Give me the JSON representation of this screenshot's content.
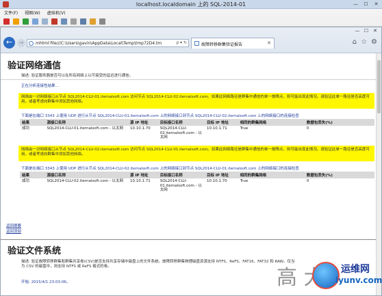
{
  "window": {
    "title": "localhost.localdomain 上的 SQL-2014-01"
  },
  "menu": [
    "文件(F)",
    "视图(W)",
    "虚拟机(V)"
  ],
  "toolbar_icons": [
    "stop-icon",
    "pause-icon",
    "play-icon",
    "snapshot-icon",
    "revert-icon",
    "power-icon",
    "reset-icon",
    "send-keys-icon",
    "usb-icon",
    "network-icon",
    "settings-icon"
  ],
  "browser": {
    "address": "mhtml:file///C:\\Users\\gavin\\AppData\\Local\\Temp\\tmp72D4.tm",
    "address_controls": "ρ ▾ ↻",
    "tab_label": "故障转移群集验证报告"
  },
  "section1": {
    "title": "验证网络通信",
    "description": "描述: 验证服务器是否可以在所有网络上以可接受的延迟进行通信。",
    "status_link": "正在分析连接性结果...",
    "warning1": "网络由一对网络接口从节点 SQL2014-CLU-01.iternalsoft.com 访问节点 SQL2014-CLU-02.iternalsoft.com。如果此网络路径是群集中通信的单一故障点，则可能出现此情况。请验证此单一路径是否高度可用，或者考虑向群集中添加其他网络。",
    "udp1": "下面是在端口 3343 上使用 UDP 进行从节点 SQL2014-CLU-01.iternalsoft.com 上的网络接口到节点 SQL2014-CLU-02.iternalsoft.com 上的网络接口的连接检查",
    "warning2": "网络由一对网络接口从节点 SQL2014-CLU-02.iternalsoft.com 访问节点 SQL2014-CLU-01.iternalsoft.com。如果此网络路径是群集中通信的单一故障点，则可能出现此情况。请验证此单一路径是否高度可用，或者考虑向群集中添加其他网络。",
    "udp2": "下面是在端口 3343 上使用 UDP 进行从节点 SQL2014-CLU-02.iternalsoft.com 上的网络接口到节点 SQL2014-CLU-01.iternalsoft.com 上的网络接口的连接检查",
    "columns": [
      "结果",
      "源接口名称",
      "源 IP 地址",
      "目标接口名称",
      "目标 IP 地址",
      "相同的群集网络",
      "数据包丢失(%)"
    ],
    "table1": [
      {
        "result": "成功",
        "src_name": "SQL2014-CLU-01.iternalsoft.com - 以太网",
        "src_ip": "10.10.1.70",
        "dst_name": "SQL2014-CLU-02.iternalsoft.com - 以太网",
        "dst_ip": "10.10.1.71",
        "same": "True",
        "loss": "0"
      }
    ],
    "table2": [
      {
        "result": "成功",
        "src_name": "SQL2014-CLU-02.iternalsoft.com - 以太网",
        "src_ip": "10.10.1.71",
        "dst_name": "SQL2014-CLU-01.iternalsoft.com - 以太网",
        "dst_ip": "10.10.1.70",
        "same": "True",
        "loss": "0"
      }
    ],
    "back_links": [
      "返回摘要",
      "返回顶部"
    ]
  },
  "section2": {
    "title": "验证文件系统",
    "description": "描述: 验证故障转移群集和群集共享卷(CSV)是否支持共享存储中磁盘上的文件系统。故障转移群集物理磁盘资源支持 NTFS、ReFS、FAT16、FAT32 和 RAW。仅当为 CSV 的磁盘中，则支持 NTFS 或 ReFS 格式的卷。",
    "start": "开始: 2015/4/1 23:03:06。"
  },
  "watermark": {
    "cn": "运维网",
    "en": "iyunv.com",
    "chars": "高  大"
  }
}
